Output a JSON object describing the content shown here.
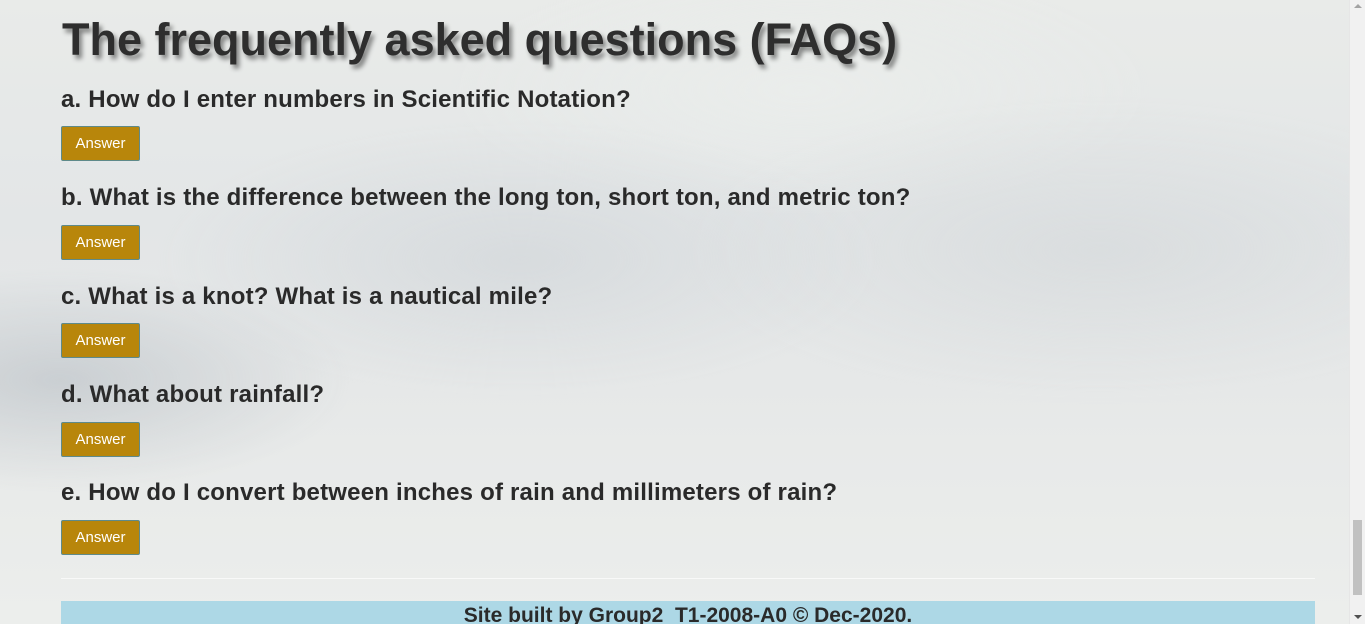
{
  "page": {
    "title": "The frequently asked questions (FAQs)"
  },
  "faqs": [
    {
      "question": "a. How do I enter numbers in Scientific Notation?",
      "button_label": "Answer"
    },
    {
      "question": "b. What is the difference between the long ton, short ton, and metric ton?",
      "button_label": "Answer"
    },
    {
      "question": "c. What is a knot? What is a nautical mile?",
      "button_label": "Answer"
    },
    {
      "question": "d. What about rainfall?",
      "button_label": "Answer"
    },
    {
      "question": "e. How do I convert between inches of rain and millimeters of rain?",
      "button_label": "Answer"
    }
  ],
  "footer": {
    "text": "Site built by Group2  T1-2008-A0 © Dec-2020."
  },
  "colors": {
    "answer_button_bg": "#b8860b",
    "answer_button_border": "#5e8a8a",
    "footer_bg": "#add8e6",
    "heading_text": "#2e2e2e"
  },
  "scrollbar": {
    "up_arrow_icon": "triangle-up",
    "down_arrow_icon": "triangle-down"
  }
}
